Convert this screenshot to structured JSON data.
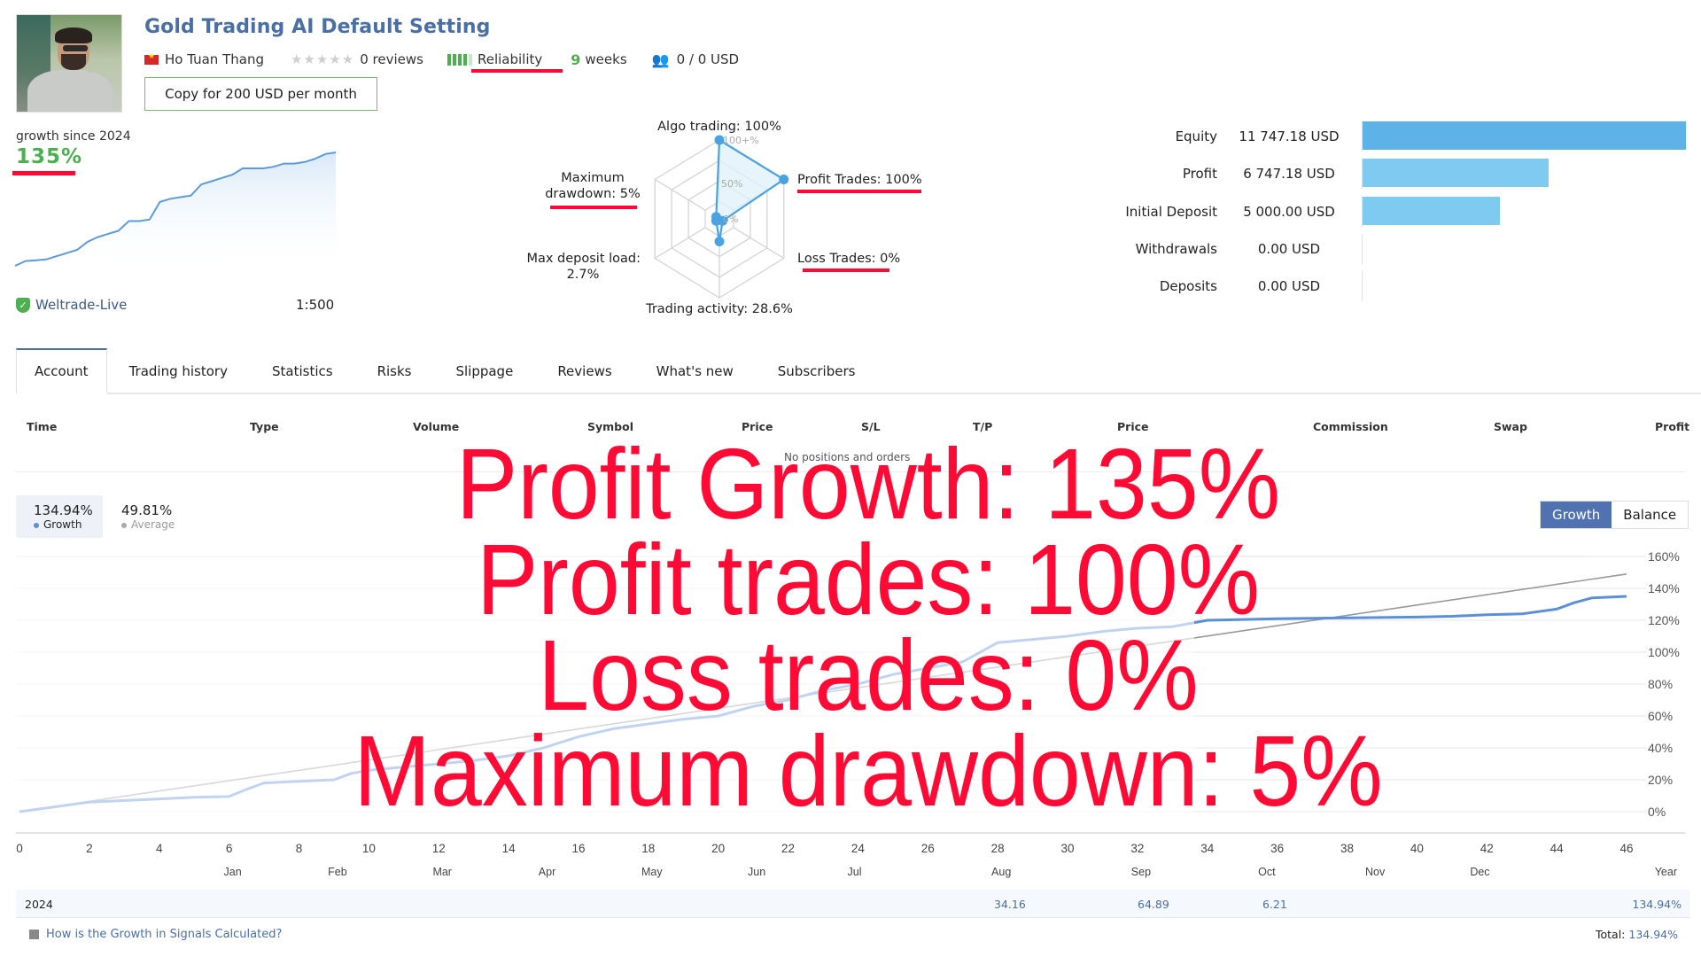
{
  "header": {
    "title": "Gold Trading AI Default Setting",
    "author": "Ho Tuan Thang",
    "country_flag": "vietnam-flag",
    "rating_stars": 0,
    "reviews": "0 reviews",
    "reliability_label": "Reliability",
    "reliability_level": 4,
    "reliability_max": 5,
    "weeks_num": "9",
    "weeks_label": "weeks",
    "subscribers": "0 / 0 USD",
    "copy_button": "Copy for 200 USD per month"
  },
  "summary": {
    "growth_label": "growth since 2024",
    "growth_value": "135%",
    "broker": "Weltrade-Live",
    "leverage": "1:500",
    "sparkline_values": [
      0,
      3,
      3.5,
      4,
      6,
      8,
      10,
      15,
      18,
      20,
      22,
      28,
      28,
      29,
      40,
      42,
      43,
      44,
      51,
      53,
      55,
      57,
      61,
      61,
      61,
      62,
      64,
      64,
      65,
      67,
      70,
      71
    ]
  },
  "radar": {
    "axes": [
      {
        "label": "Algo trading: 100%",
        "value": 100
      },
      {
        "label": "Profit Trades: 100%",
        "value": 100
      },
      {
        "label": "Loss Trades: 0%",
        "value": 0
      },
      {
        "label": "Trading activity: 28.6%",
        "value": 28.6
      },
      {
        "label_line1": "Max deposit load:",
        "label_line2": "2.7%",
        "value": 2.7
      },
      {
        "label_line1": "Maximum",
        "label_line2": "drawdown: 5%",
        "value": 5
      }
    ],
    "scale_labels": [
      "100+%",
      "50%",
      "0%"
    ]
  },
  "equity": [
    {
      "label": "Equity",
      "value": "11 747.18 USD",
      "amount": 11747.18
    },
    {
      "label": "Profit",
      "value": "6 747.18 USD",
      "amount": 6747.18
    },
    {
      "label": "Initial Deposit",
      "value": "5 000.00 USD",
      "amount": 5000.0
    },
    {
      "label": "Withdrawals",
      "value": "0.00 USD",
      "amount": 0
    },
    {
      "label": "Deposits",
      "value": "0.00 USD",
      "amount": 0
    }
  ],
  "tabs": [
    "Account",
    "Trading history",
    "Statistics",
    "Risks",
    "Slippage",
    "Reviews",
    "What's new",
    "Subscribers"
  ],
  "active_tab": 0,
  "positions": {
    "columns": [
      "Time",
      "Type",
      "Volume",
      "Symbol",
      "Price",
      "S/L",
      "T/P",
      "Price",
      "Commission",
      "Swap",
      "Profit"
    ],
    "empty_text": "No positions and orders"
  },
  "growth_stats": {
    "growth_value": "134.94%",
    "growth_label": "Growth",
    "average_value": "49.81%",
    "average_label": "Average",
    "toggle": [
      "Growth",
      "Balance"
    ],
    "toggle_active": "Growth"
  },
  "chart_data": {
    "type": "line",
    "title": "",
    "xlabel": "",
    "ylabel": "",
    "x_ticks": [
      0,
      2,
      4,
      6,
      8,
      10,
      12,
      14,
      16,
      18,
      20,
      22,
      24,
      26,
      28,
      30,
      32,
      34,
      36,
      38,
      40,
      42,
      44,
      46
    ],
    "month_labels": [
      {
        "label": "Jan",
        "x": 6
      },
      {
        "label": "Feb",
        "x": 9
      },
      {
        "label": "Mar",
        "x": 12
      },
      {
        "label": "Apr",
        "x": 15
      },
      {
        "label": "May",
        "x": 18
      },
      {
        "label": "Jun",
        "x": 21
      },
      {
        "label": "Jul",
        "x": 23.8
      },
      {
        "label": "Aug",
        "x": 28
      },
      {
        "label": "Sep",
        "x": 32
      },
      {
        "label": "Oct",
        "x": 35.6
      },
      {
        "label": "Nov",
        "x": 38.7
      },
      {
        "label": "Dec",
        "x": 41.7
      },
      {
        "label": "Year",
        "x": 46
      }
    ],
    "y_ticks": [
      "0%",
      "20%",
      "40%",
      "60%",
      "80%",
      "100%",
      "120%",
      "140%",
      "160%"
    ],
    "xlim": [
      0,
      46
    ],
    "ylim": [
      0,
      160
    ],
    "grid": true,
    "series": [
      {
        "name": "Growth",
        "color": "#5b8fd9",
        "x": [
          0,
          1,
          2,
          4,
          5,
          6,
          6.5,
          7,
          8,
          9,
          9.5,
          10,
          11,
          12,
          13,
          14,
          15,
          16,
          17,
          18,
          19,
          20,
          21,
          22,
          23,
          24,
          25,
          26,
          27,
          27.5,
          28,
          29,
          30,
          31,
          32,
          33,
          34,
          36,
          38,
          40,
          41,
          42,
          43,
          44,
          44.5,
          45,
          46
        ],
        "y": [
          0,
          3,
          6,
          8,
          9,
          9.5,
          14,
          18,
          19,
          20,
          24,
          26,
          28,
          30,
          32,
          35,
          40,
          47,
          52,
          55,
          58,
          60,
          66,
          70,
          76,
          80,
          86,
          90,
          94,
          100,
          106,
          108,
          110,
          113,
          115,
          116,
          120,
          121,
          121.5,
          122,
          122.5,
          123.5,
          124,
          127,
          131,
          134,
          135
        ]
      },
      {
        "name": "Average",
        "color": "#999999",
        "x": [
          0,
          46
        ],
        "y": [
          0,
          149
        ]
      }
    ]
  },
  "monthly_table": {
    "year": "2024",
    "values": [
      {
        "month": "Aug",
        "value": "34.16"
      },
      {
        "month": "Sep",
        "value": "64.89"
      },
      {
        "month": "Oct",
        "value": "6.21"
      },
      {
        "month": "Year",
        "value": "134.94%"
      }
    ]
  },
  "footer": {
    "help_link": "How is the Growth in Signals Calculated?",
    "total_label": "Total:",
    "total_value": "134.94%"
  },
  "overlay": {
    "lines": [
      "Profit Growth: 135%",
      "Profit trades: 100%",
      "Loss trades: 0%",
      "Maximum drawdown: 5%"
    ],
    "color": "#ff0a35"
  }
}
